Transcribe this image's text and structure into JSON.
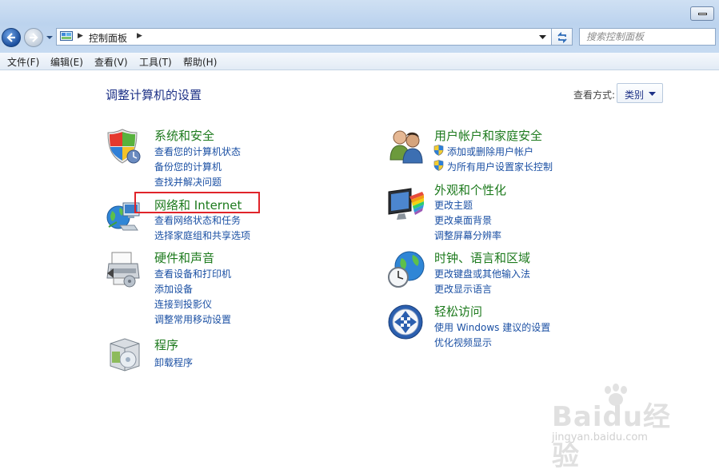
{
  "address": {
    "crumb": "控制面板"
  },
  "search": {
    "placeholder": "搜索控制面板"
  },
  "menu": [
    "文件(F)",
    "编辑(E)",
    "查看(V)",
    "工具(T)",
    "帮助(H)"
  ],
  "page_title": "调整计算机的设置",
  "view_by": {
    "label": "查看方式:",
    "value": "类别"
  },
  "categories": {
    "system_security": {
      "title": "系统和安全",
      "links": [
        "查看您的计算机状态",
        "备份您的计算机",
        "查找并解决问题"
      ]
    },
    "network": {
      "title": "网络和 Internet",
      "links": [
        "查看网络状态和任务",
        "选择家庭组和共享选项"
      ]
    },
    "hardware": {
      "title": "硬件和声音",
      "links": [
        "查看设备和打印机",
        "添加设备",
        "连接到投影仪",
        "调整常用移动设置"
      ]
    },
    "programs": {
      "title": "程序",
      "links": [
        "卸载程序"
      ]
    },
    "user_accounts": {
      "title": "用户帐户和家庭安全",
      "links": [
        "添加或删除用户帐户",
        "为所有用户设置家长控制"
      ]
    },
    "appearance": {
      "title": "外观和个性化",
      "links": [
        "更改主题",
        "更改桌面背景",
        "调整屏幕分辨率"
      ]
    },
    "clock": {
      "title": "时钟、语言和区域",
      "links": [
        "更改键盘或其他输入法",
        "更改显示语言"
      ]
    },
    "ease": {
      "title": "轻松访问",
      "links": [
        "使用 Windows 建议的设置",
        "优化视频显示"
      ]
    }
  },
  "watermark": {
    "brand": "Baidu经验",
    "url": "jingyan.baidu.com"
  },
  "colors": {
    "category_title": "#1d7a1d",
    "link": "#1a4fa3",
    "highlight": "#e0242a",
    "title": "#1e3287"
  }
}
